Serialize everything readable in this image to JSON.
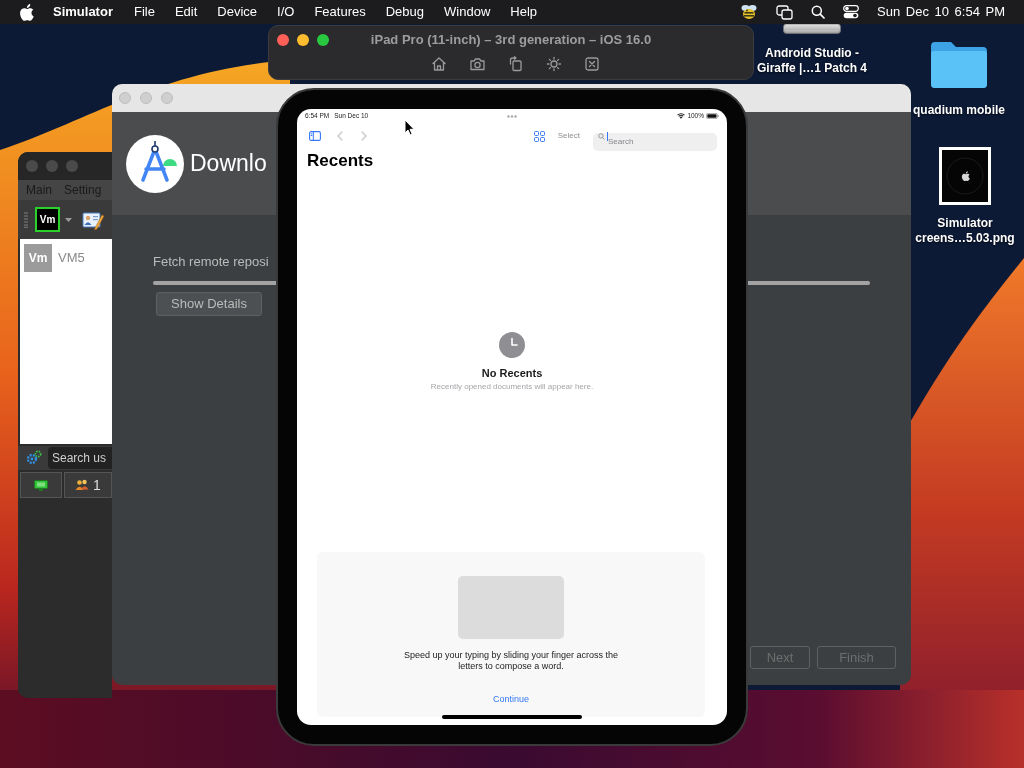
{
  "menu_bar": {
    "app_name": "Simulator",
    "menus": [
      "File",
      "Edit",
      "Device",
      "I/O",
      "Features",
      "Debug",
      "Window",
      "Help"
    ],
    "clock": "Sun Dec 10 6:54 PM"
  },
  "simulator_window": {
    "title": "iPad Pro (11-inch) – 3rd generation – iOS 16.0"
  },
  "vm_window": {
    "menus": [
      "Main",
      "Setting"
    ],
    "toolbar_logo": "Vm",
    "machines": [
      {
        "logo": "Vm",
        "name": "VM5",
        "selected": false
      }
    ],
    "search": {
      "placeholder": "Search us"
    },
    "user_count": "1"
  },
  "installer_window": {
    "heading": "Downlo",
    "task": "Fetch remote reposi",
    "progress": {
      "level": 1
    },
    "details_button": "Show Details",
    "buttons": [
      {
        "label": "Next",
        "disabled": true
      },
      {
        "label": "Finish",
        "disabled": true
      }
    ]
  },
  "ipad": {
    "status_bar": {
      "time": "6:54 PM",
      "date": "Sun Dec 10",
      "battery": "100%"
    },
    "nav": {
      "back": {
        "disabled": true
      },
      "forward": {
        "disabled": true
      },
      "select": {
        "label": "Select",
        "disabled": true
      },
      "search": {
        "placeholder": "Search",
        "focused": true
      }
    },
    "title": "Recents",
    "empty_state": {
      "title": "No Recents",
      "message": "Recently opened documents will appear here."
    },
    "tip": {
      "message": "Speed up your typing by sliding your finger across the letters to compose a word.",
      "action": "Continue"
    }
  },
  "desktop_icons": [
    {
      "kind": "disk",
      "label": "Android Studio - Giraffe |…1 Patch 4"
    },
    {
      "kind": "folder",
      "label": "quadium mobile"
    },
    {
      "kind": "image",
      "label": "Simulator creens…5.03.png"
    }
  ]
}
